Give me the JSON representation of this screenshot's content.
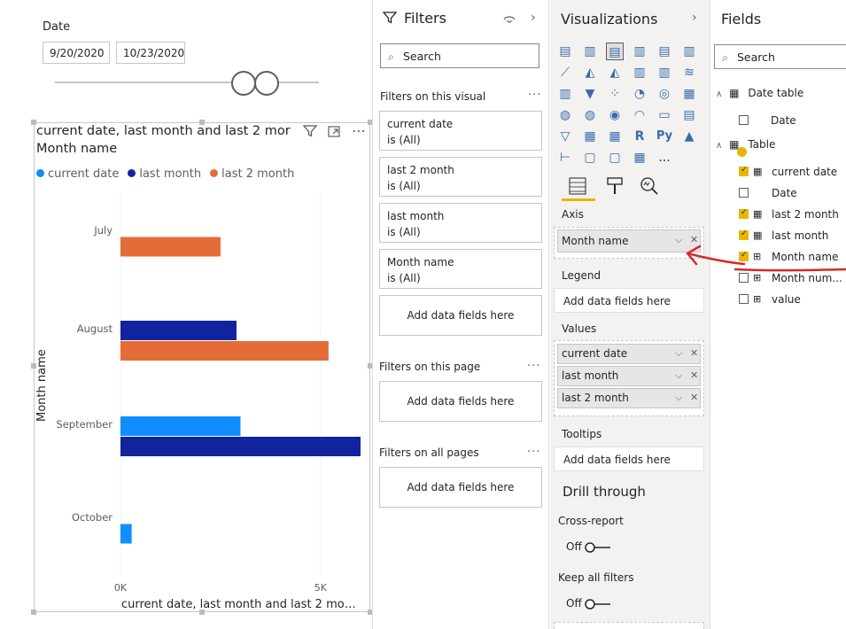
{
  "slicer": {
    "title": "Date",
    "start_date": "9/20/2020",
    "end_date": "10/23/2020"
  },
  "visual": {
    "title_line1": "current date, last month and last 2 mor",
    "title_line2": "Month name",
    "y_axis_title": "Month name",
    "x_axis_title": "current date, last month and last 2 mon..."
  },
  "chart_data": {
    "type": "bar",
    "orientation": "horizontal",
    "categories": [
      "July",
      "August",
      "September",
      "October"
    ],
    "series": [
      {
        "name": "current date",
        "color": "#118dff",
        "values": [
          null,
          null,
          3000,
          280
        ]
      },
      {
        "name": "last month",
        "color": "#12239e",
        "values": [
          null,
          2900,
          6000,
          null
        ]
      },
      {
        "name": "last 2 month",
        "color": "#e66c37",
        "values": [
          2500,
          5200,
          null,
          null
        ]
      }
    ],
    "x_ticks": [
      "0K",
      "5K"
    ],
    "xlim": [
      0,
      6000
    ],
    "grid": true,
    "legend_position": "top-left"
  },
  "filters": {
    "title": "Filters",
    "search_placeholder": "Search",
    "on_visual_label": "Filters on this visual",
    "cards": [
      {
        "field": "current date",
        "state": "is (All)"
      },
      {
        "field": "last 2 month",
        "state": "is (All)"
      },
      {
        "field": "last month",
        "state": "is (All)"
      },
      {
        "field": "Month name",
        "state": "is (All)"
      }
    ],
    "add_label": "Add data fields here",
    "on_page_label": "Filters on this page",
    "on_all_label": "Filters on all pages"
  },
  "viz": {
    "title": "Visualizations",
    "axis_label": "Axis",
    "axis_field": "Month name",
    "legend_label": "Legend",
    "add_label": "Add data fields here",
    "values_label": "Values",
    "values": [
      "current date",
      "last month",
      "last 2 month"
    ],
    "tooltips_label": "Tooltips",
    "drill_title": "Drill through",
    "cross_report": "Cross-report",
    "cross_state": "Off",
    "keep_filters": "Keep all filters",
    "keep_state": "Off",
    "more": "...",
    "r_icon": "R",
    "py_icon": "Py",
    "annotation_color": "#d42a2a"
  },
  "fields": {
    "title": "Fields",
    "search_placeholder": "Search",
    "tables": [
      {
        "name": "Date table",
        "items": [
          {
            "name": "Date",
            "checked": false
          }
        ]
      },
      {
        "name": "Table",
        "items": [
          {
            "name": "current date",
            "checked": true
          },
          {
            "name": "Date",
            "checked": false
          },
          {
            "name": "last 2 month",
            "checked": true
          },
          {
            "name": "last month",
            "checked": true
          },
          {
            "name": "Month name",
            "checked": true
          },
          {
            "name": "Month num...",
            "checked": false
          },
          {
            "name": "value",
            "checked": false
          }
        ]
      }
    ]
  }
}
